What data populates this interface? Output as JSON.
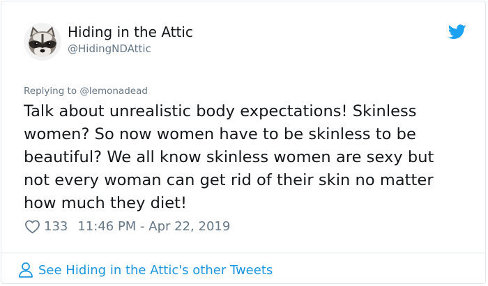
{
  "tweet": {
    "author_name": "Hiding in the Attic",
    "author_handle": "@HidingNDAttic",
    "avatar_icon": "raccoon-avatar",
    "platform_icon": "twitter-bird-icon",
    "brand_color": "#1da1f2",
    "reply_context": "Replying to @lemonadead",
    "text_lines": [
      "Talk about unrealistic body expectations! Skinless",
      "women? So now women have to be skinless to be",
      "beautiful? We all know skinless women are sexy but",
      "not every woman can get rid of their skin no matter",
      "how much they diet!"
    ],
    "like_count": "133",
    "timestamp": "11:46 PM - Apr 22, 2019",
    "like_icon": "heart-outline-icon"
  },
  "footer": {
    "link_text": "See Hiding in the Attic's other Tweets",
    "link_icon": "person-icon",
    "link_color": "#1b95e0"
  }
}
